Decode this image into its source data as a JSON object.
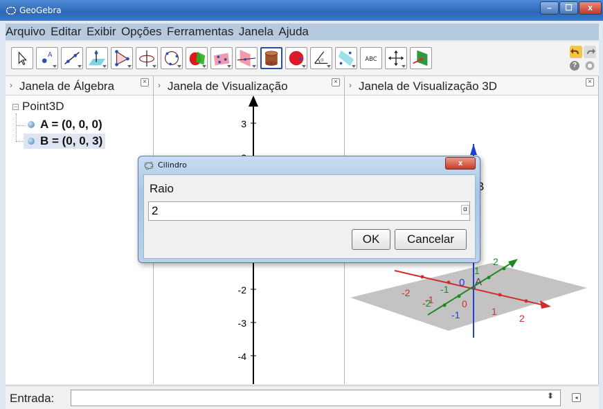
{
  "window": {
    "title": "GeoGebra",
    "controls": {
      "minimize": "–",
      "maximize": "☐",
      "close": "x"
    }
  },
  "menu": [
    "Arquivo",
    "Editar",
    "Exibir",
    "Opções",
    "Ferramentas",
    "Janela",
    "Ajuda"
  ],
  "toolbar": {
    "tools": [
      {
        "icon": "move-arrow-icon"
      },
      {
        "icon": "point-icon"
      },
      {
        "icon": "line-icon"
      },
      {
        "icon": "perpendicular-line-icon"
      },
      {
        "icon": "polygon-icon"
      },
      {
        "icon": "circle-axis-icon"
      },
      {
        "icon": "circle-three-points-icon"
      },
      {
        "icon": "intersect-surfaces-icon"
      },
      {
        "icon": "plane-three-points-icon"
      },
      {
        "icon": "plane-icon"
      },
      {
        "icon": "cylinder-icon",
        "selected": true
      },
      {
        "icon": "sphere-icon"
      },
      {
        "icon": "angle-icon"
      },
      {
        "icon": "reflect-icon"
      },
      {
        "icon": "text-icon",
        "text": "ABC"
      },
      {
        "icon": "move-view-icon"
      },
      {
        "icon": "rotate-view-icon"
      }
    ]
  },
  "panels": {
    "algebra": {
      "title": "Janela de Álgebra",
      "folder": "Point3D",
      "items": [
        {
          "label": "A = (0, 0, 0)",
          "highlighted": false
        },
        {
          "label": "B = (0, 0, 3)",
          "highlighted": true
        }
      ]
    },
    "graphics": {
      "title": "Janela de Visualização",
      "y_ticks": [
        "3",
        "2",
        "-2",
        "-3",
        "-4"
      ]
    },
    "graphics3d": {
      "title": "Janela de Visualização 3D",
      "point_labels": [
        "A",
        "B"
      ],
      "x_ticks": [
        "-2",
        "-1",
        "0",
        "1",
        "2"
      ],
      "y_ticks": [
        "-2",
        "-1",
        "1",
        "2"
      ],
      "z_ticks": [
        "0",
        "-1"
      ]
    }
  },
  "dialog": {
    "title": "Cilindro",
    "label": "Raio",
    "value": "2",
    "alpha_button": "α",
    "ok": "OK",
    "cancel": "Cancelar",
    "close": "x"
  },
  "input_bar": {
    "label": "Entrada:",
    "value": "",
    "spinner": "⬍"
  },
  "colors": {
    "x_axis": "#d22d2d",
    "y_axis": "#1e8a1e",
    "z_axis": "#1d3fd6",
    "plane": "#b8b8b8",
    "point_B": "#1d3fd6"
  }
}
